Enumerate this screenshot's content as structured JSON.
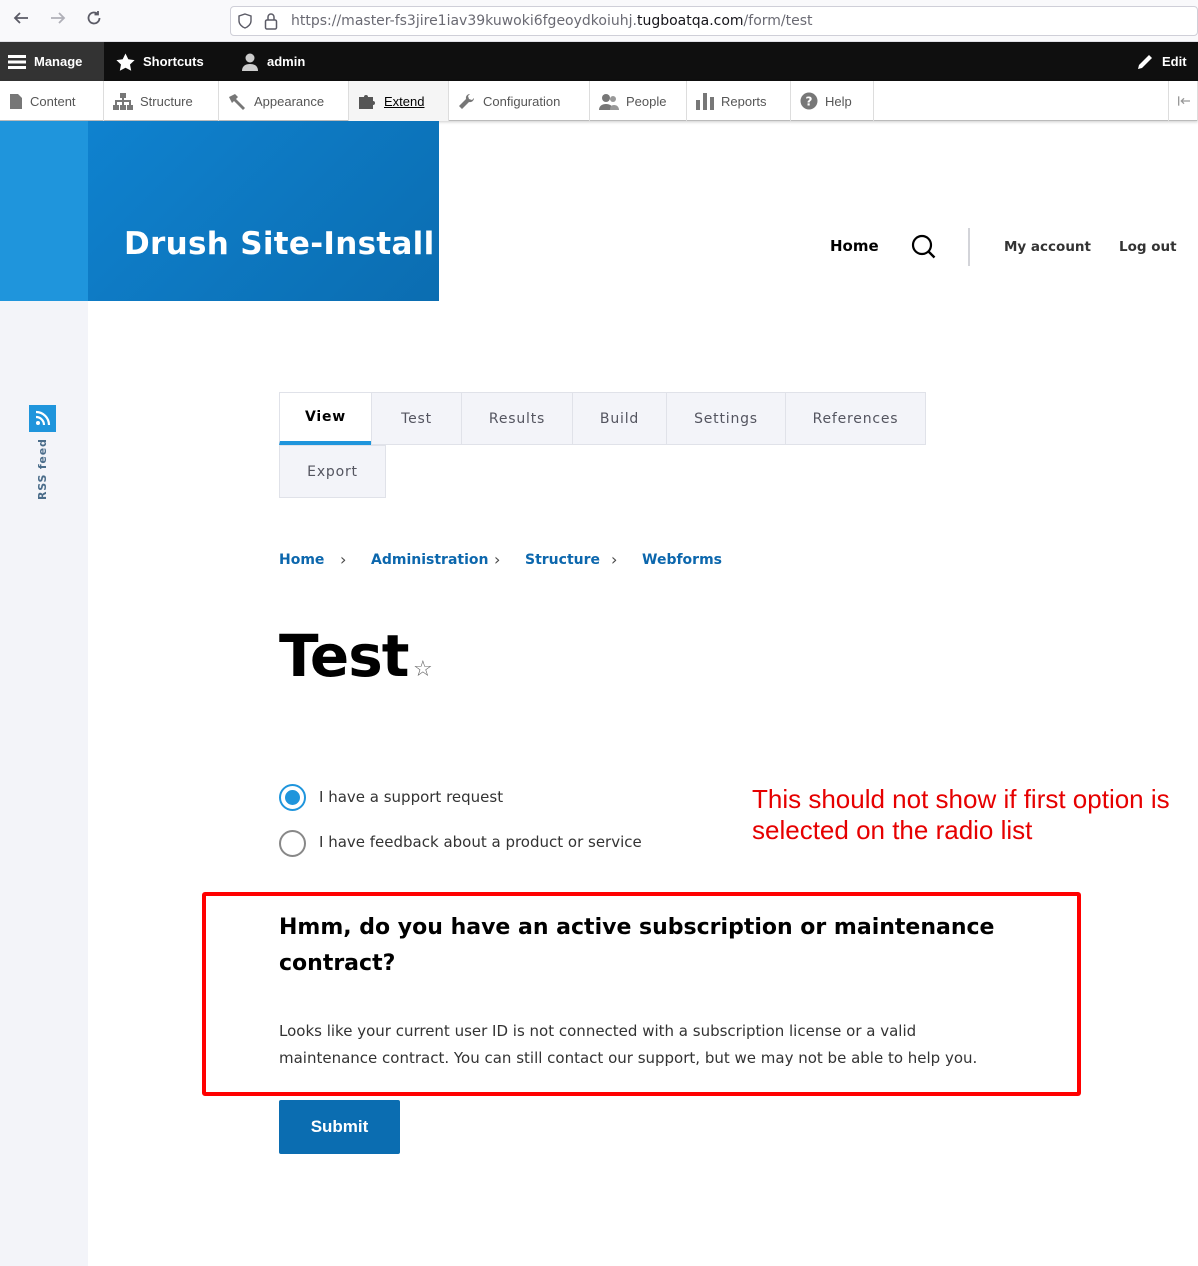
{
  "browser": {
    "url_prefix": "https://master-fs3jire1iav39kuwoki6fgeoydkoiuhj.",
    "url_domain": "tugboatqa.com",
    "url_path": "/form/test"
  },
  "admin_toolbar": {
    "manage": "Manage",
    "shortcuts": "Shortcuts",
    "user": "admin",
    "edit": "Edit"
  },
  "admin_menu": {
    "items": [
      {
        "label": "Content",
        "icon": "content-icon"
      },
      {
        "label": "Structure",
        "icon": "structure-icon"
      },
      {
        "label": "Appearance",
        "icon": "appearance-icon"
      },
      {
        "label": "Extend",
        "icon": "extend-icon"
      },
      {
        "label": "Configuration",
        "icon": "configuration-icon"
      },
      {
        "label": "People",
        "icon": "people-icon"
      },
      {
        "label": "Reports",
        "icon": "reports-icon"
      },
      {
        "label": "Help",
        "icon": "help-icon"
      }
    ]
  },
  "site": {
    "name": "Drush Site-Install",
    "main_nav_home": "Home",
    "my_account": "My account",
    "log_out": "Log out",
    "rss": "RSS feed",
    "accent": "#1f95dc"
  },
  "tabs": [
    "View",
    "Test",
    "Results",
    "Build",
    "Settings",
    "References",
    "Export"
  ],
  "breadcrumb": [
    "Home",
    "Administration",
    "Structure",
    "Webforms"
  ],
  "page": {
    "title": "Test"
  },
  "form": {
    "options": [
      {
        "label": "I have a support request",
        "checked": true
      },
      {
        "label": "I have feedback about a product or service",
        "checked": false
      }
    ],
    "message_title": "Hmm, do you have an active subscription or maintenance contract?",
    "message_body": "Looks like your current user ID is not connected with a subscription license or a valid maintenance contract. You can still contact our support, but we may not be able to help you.",
    "submit": "Submit"
  },
  "annotation": {
    "text": "This should not show if first option is selected on the radio list",
    "color": "#ff0000"
  }
}
